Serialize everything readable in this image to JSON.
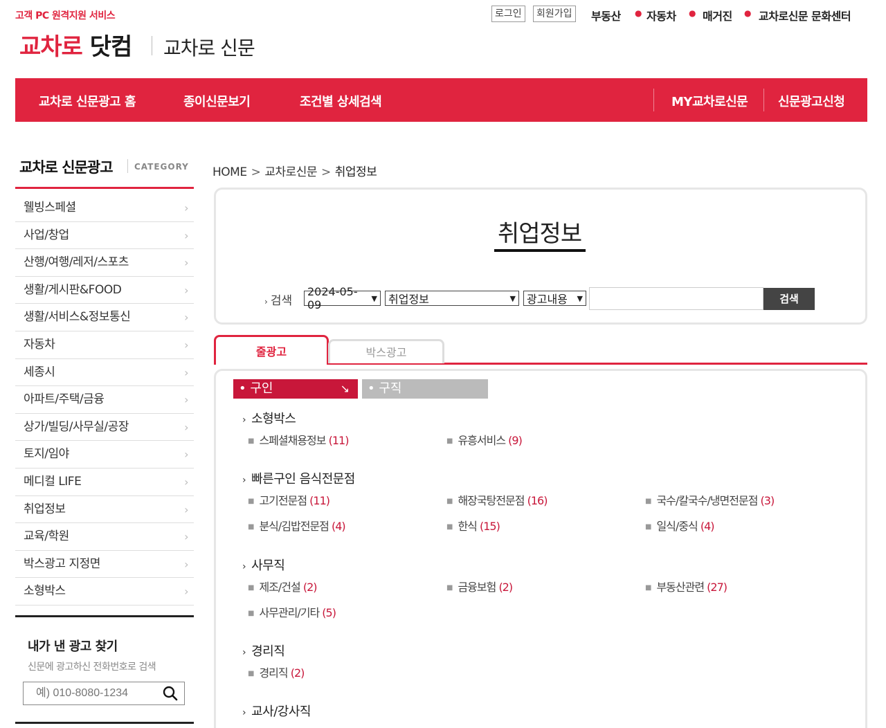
{
  "header": {
    "remote_support": "고객 PC 원격지원 서비스",
    "logo_red": "교차로",
    "logo_dark": "닷컴",
    "logo_sub": "교차로 신문",
    "login": "로그인",
    "join": "회원가입",
    "top_links": [
      "부동산",
      "자동차",
      "매거진",
      "교차로신문 문화센터"
    ]
  },
  "nav": {
    "items": [
      "교차로 신문광고 홈",
      "종이신문보기",
      "조건별 상세검색"
    ],
    "right_items": [
      "MY교차로신문",
      "신문광고신청"
    ]
  },
  "sidebar": {
    "title": "교차로 신문광고",
    "title_en": "CATEGORY",
    "items": [
      "웰빙스페셜",
      "사업/창업",
      "산행/여행/레저/스포츠",
      "생활/게시판&FOOD",
      "생활/서비스&정보통신",
      "자동차",
      "세종시",
      "아파트/주택/금융",
      "상가/빌딩/사무실/공장",
      "토지/임야",
      "메디컬 LIFE",
      "취업정보",
      "교육/학원",
      "박스광고 지정면",
      "소형박스"
    ],
    "find_title": "내가 낸 광고 찾기",
    "find_sub": "신문에 광고하신 전화번호로 검색",
    "find_placeholder": "예) 010-8080-1234"
  },
  "breadcrumb": [
    "HOME",
    "교차로신문",
    "취업정보"
  ],
  "search": {
    "title": "취업정보",
    "label": "검색",
    "date": "2024-05-09",
    "category": "취업정보",
    "field": "광고내용",
    "button": "검색"
  },
  "tabs": [
    "줄광고",
    "박스광고"
  ],
  "subtabs": [
    "구인",
    "구직"
  ],
  "groups": [
    {
      "title": "소형박스",
      "items": [
        {
          "name": "스페셜채용정보",
          "count": "(11)"
        },
        {
          "name": "유흥서비스",
          "count": "(9)"
        }
      ]
    },
    {
      "title": "빠른구인 음식전문점",
      "items": [
        {
          "name": "고기전문점",
          "count": "(11)"
        },
        {
          "name": "해장국탕전문점",
          "count": "(16)"
        },
        {
          "name": "국수/칼국수/냉면전문점",
          "count": "(3)"
        },
        {
          "name": "분식/김밥전문점",
          "count": "(4)"
        },
        {
          "name": "한식",
          "count": "(15)"
        },
        {
          "name": "일식/중식",
          "count": "(4)"
        }
      ]
    },
    {
      "title": "사무직",
      "items": [
        {
          "name": "제조/건설",
          "count": "(2)"
        },
        {
          "name": "금융보험",
          "count": "(2)"
        },
        {
          "name": "부동산관련",
          "count": "(27)"
        },
        {
          "name": "사무관리/기타",
          "count": "(5)"
        }
      ]
    },
    {
      "title": "경리직",
      "items": [
        {
          "name": "경리직",
          "count": "(2)"
        }
      ]
    },
    {
      "title": "교사/강사직",
      "items": []
    }
  ],
  "colors": {
    "brand": "#e0243f",
    "accent_dark": "#c8173a"
  }
}
